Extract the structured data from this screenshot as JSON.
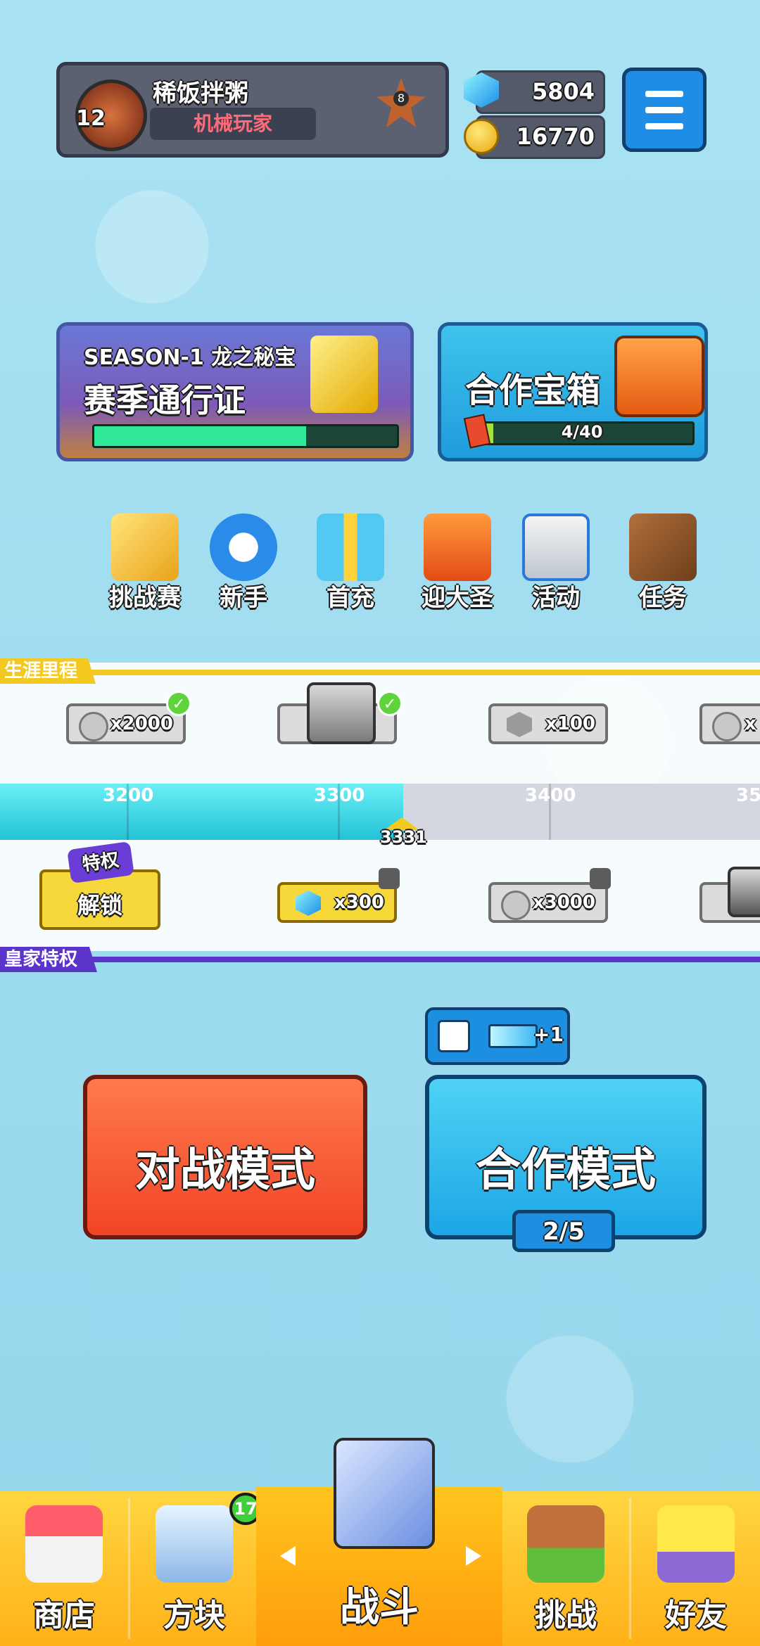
{
  "profile": {
    "name": "稀饭拌粥",
    "title": "机械玩家",
    "level": "12",
    "rank": "8"
  },
  "currency": {
    "gems": "5804",
    "coins": "16770"
  },
  "season_pass": {
    "season": "SEASON-1 龙之秘宝",
    "label": "赛季通行证",
    "progress": 0.7
  },
  "coop_chest": {
    "label": "合作宝箱",
    "progress_text": "4/40",
    "progress": 0.1
  },
  "quick_links": [
    {
      "label": "挑战赛",
      "icon": "challenge-trophy-icon"
    },
    {
      "label": "新手",
      "icon": "stopwatch-icon"
    },
    {
      "label": "首充",
      "icon": "gift-box-icon"
    },
    {
      "label": "迎大圣",
      "icon": "castle-icon"
    },
    {
      "label": "活动",
      "icon": "document-icon"
    },
    {
      "label": "任务",
      "icon": "book-icon"
    }
  ],
  "milestone": {
    "title": "生涯里程",
    "free_rewards": [
      "x2000",
      "",
      "x100",
      "x"
    ],
    "ticks": [
      "3200",
      "3300",
      "3400",
      "35"
    ],
    "current": "3331",
    "royal_title": "皇家特权",
    "unlock_badge": "特权",
    "unlock_label": "解锁",
    "royal_rewards": [
      "x300",
      "x3000"
    ]
  },
  "modes": {
    "battle": "对战模式",
    "coop": "合作模式",
    "coop_count": "2/5",
    "ad_bonus": "+1"
  },
  "nav": [
    {
      "label": "商店",
      "icon": "shop-icon"
    },
    {
      "label": "方块",
      "icon": "dice-block-icon",
      "badge": "17"
    },
    {
      "label": "战斗",
      "icon": "battle-shield-icon"
    },
    {
      "label": "挑战",
      "icon": "signboard-icon"
    },
    {
      "label": "好友",
      "icon": "friend-icon"
    }
  ]
}
